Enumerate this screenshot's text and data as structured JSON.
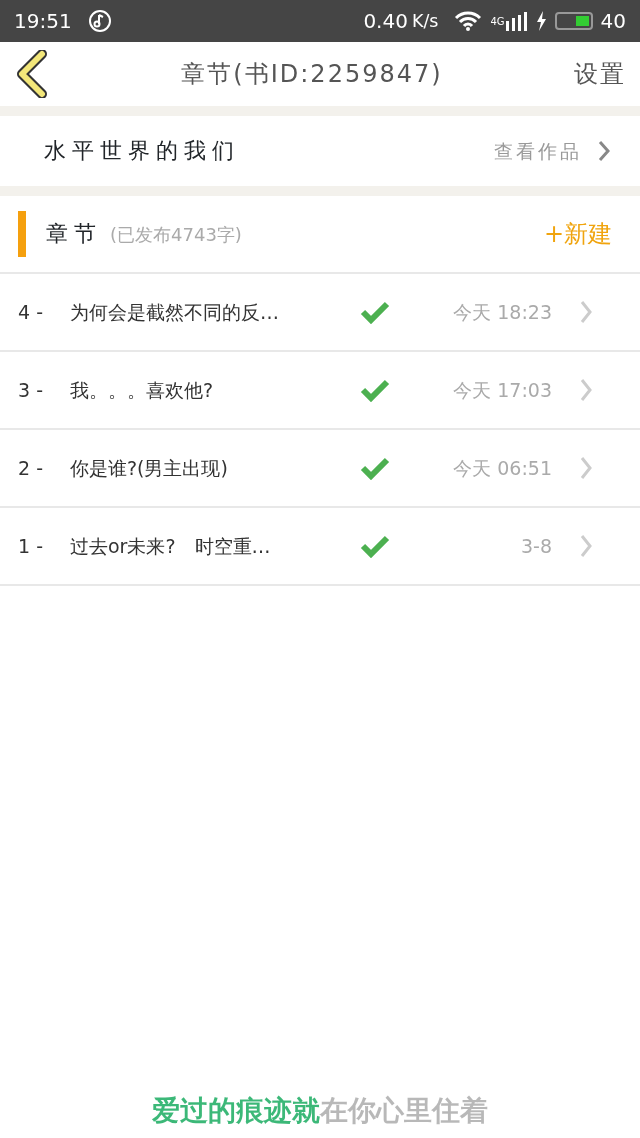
{
  "status_bar": {
    "time": "19:51",
    "speed": "0.40",
    "speed_unit": "K/s",
    "network": "4G",
    "battery_text": "40"
  },
  "header": {
    "title": "章节(书ID:2259847)",
    "settings": "设置"
  },
  "book": {
    "title": "水平世界的我们",
    "link": "查看作品"
  },
  "section": {
    "title": "章节",
    "subtitle": "(已发布4743字)",
    "new_button": "+新建"
  },
  "chapters": [
    {
      "number": "4 -",
      "title": "为何会是截然不同的反…",
      "published": true,
      "time": "今天 18:23"
    },
    {
      "number": "3 -",
      "title": "我。。。喜欢他?",
      "published": true,
      "time": "今天 17:03"
    },
    {
      "number": "2 -",
      "title": "你是谁?(男主出现)",
      "published": true,
      "time": "今天 06:51"
    },
    {
      "number": "1 -",
      "title": "过去or未来?　时空重…",
      "published": true,
      "time": "3-8"
    }
  ],
  "footer_text": "爱过的痕迹就在你心里住着"
}
